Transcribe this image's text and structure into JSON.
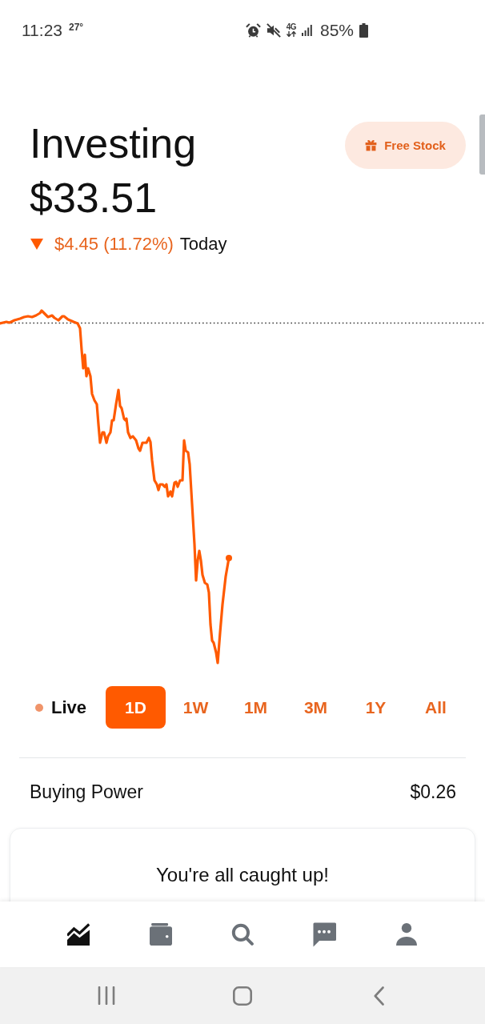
{
  "status_bar": {
    "time": "11:23",
    "temperature": "27°",
    "network": "4G",
    "battery": "85%"
  },
  "header": {
    "title": "Investing",
    "balance": "$33.51",
    "change": {
      "negative": true,
      "amount": "$4.45 (11.72%)",
      "period": "Today"
    },
    "free_stock_button": {
      "label": "Free Stock"
    }
  },
  "period_selector": {
    "live_label": "Live",
    "periods": [
      {
        "label": "1D",
        "selected": true
      },
      {
        "label": "1W",
        "selected": false
      },
      {
        "label": "1M",
        "selected": false
      },
      {
        "label": "3M",
        "selected": false
      },
      {
        "label": "1Y",
        "selected": false
      },
      {
        "label": "All",
        "selected": false
      }
    ]
  },
  "buying_power": {
    "label": "Buying Power",
    "value": "$0.26"
  },
  "card": {
    "message": "You're all caught up!"
  },
  "bottom_nav": {
    "items": [
      {
        "kind": "portfolio",
        "selected": true
      },
      {
        "kind": "wallet",
        "selected": false
      },
      {
        "kind": "search",
        "selected": false
      },
      {
        "kind": "messages",
        "selected": false
      },
      {
        "kind": "account",
        "selected": false
      }
    ]
  }
}
